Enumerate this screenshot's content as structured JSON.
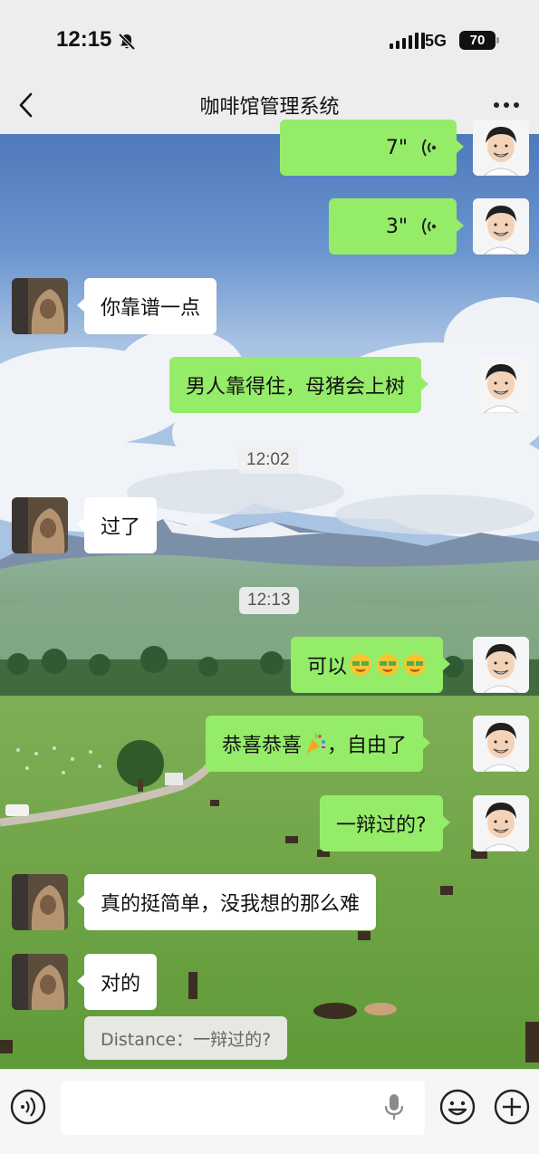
{
  "status_bar": {
    "time": "12:15",
    "network": "5G",
    "battery": "70"
  },
  "navbar": {
    "title": "咖啡馆管理系统"
  },
  "messages": [
    {
      "side": "me",
      "type": "voice",
      "duration": "7\""
    },
    {
      "side": "me",
      "type": "voice",
      "duration": "3\""
    },
    {
      "side": "other",
      "type": "text",
      "text": "你靠谱一点"
    },
    {
      "side": "me",
      "type": "text",
      "text": "男人靠得住，母猪会上树"
    },
    {
      "type": "timestamp",
      "text": "12:02"
    },
    {
      "side": "other",
      "type": "text",
      "text": "过了"
    },
    {
      "type": "timestamp",
      "text": "12:13"
    },
    {
      "side": "me",
      "type": "text",
      "text": "可以",
      "emojis": [
        "money-eyes-emoji",
        "money-eyes-emoji",
        "money-eyes-emoji"
      ]
    },
    {
      "side": "me",
      "type": "text",
      "text_before": "恭喜恭喜",
      "emoji": "party-popper-emoji",
      "text_after": "，自由了"
    },
    {
      "side": "me",
      "type": "text",
      "text": "一辩过的?"
    },
    {
      "side": "other",
      "type": "text",
      "text": "真的挺简单，没我想的那么难"
    },
    {
      "side": "other",
      "type": "text",
      "text": "对的"
    },
    {
      "type": "quote",
      "text": "Distance：一辩过的?"
    }
  ],
  "input_bar": {
    "icons": [
      "voice-mode-icon",
      "microphone-icon",
      "emoji-icon",
      "plus-icon"
    ]
  },
  "colors": {
    "my_bubble": "#95ec69",
    "other_bubble": "#ffffff",
    "header_bg": "#ededed"
  }
}
